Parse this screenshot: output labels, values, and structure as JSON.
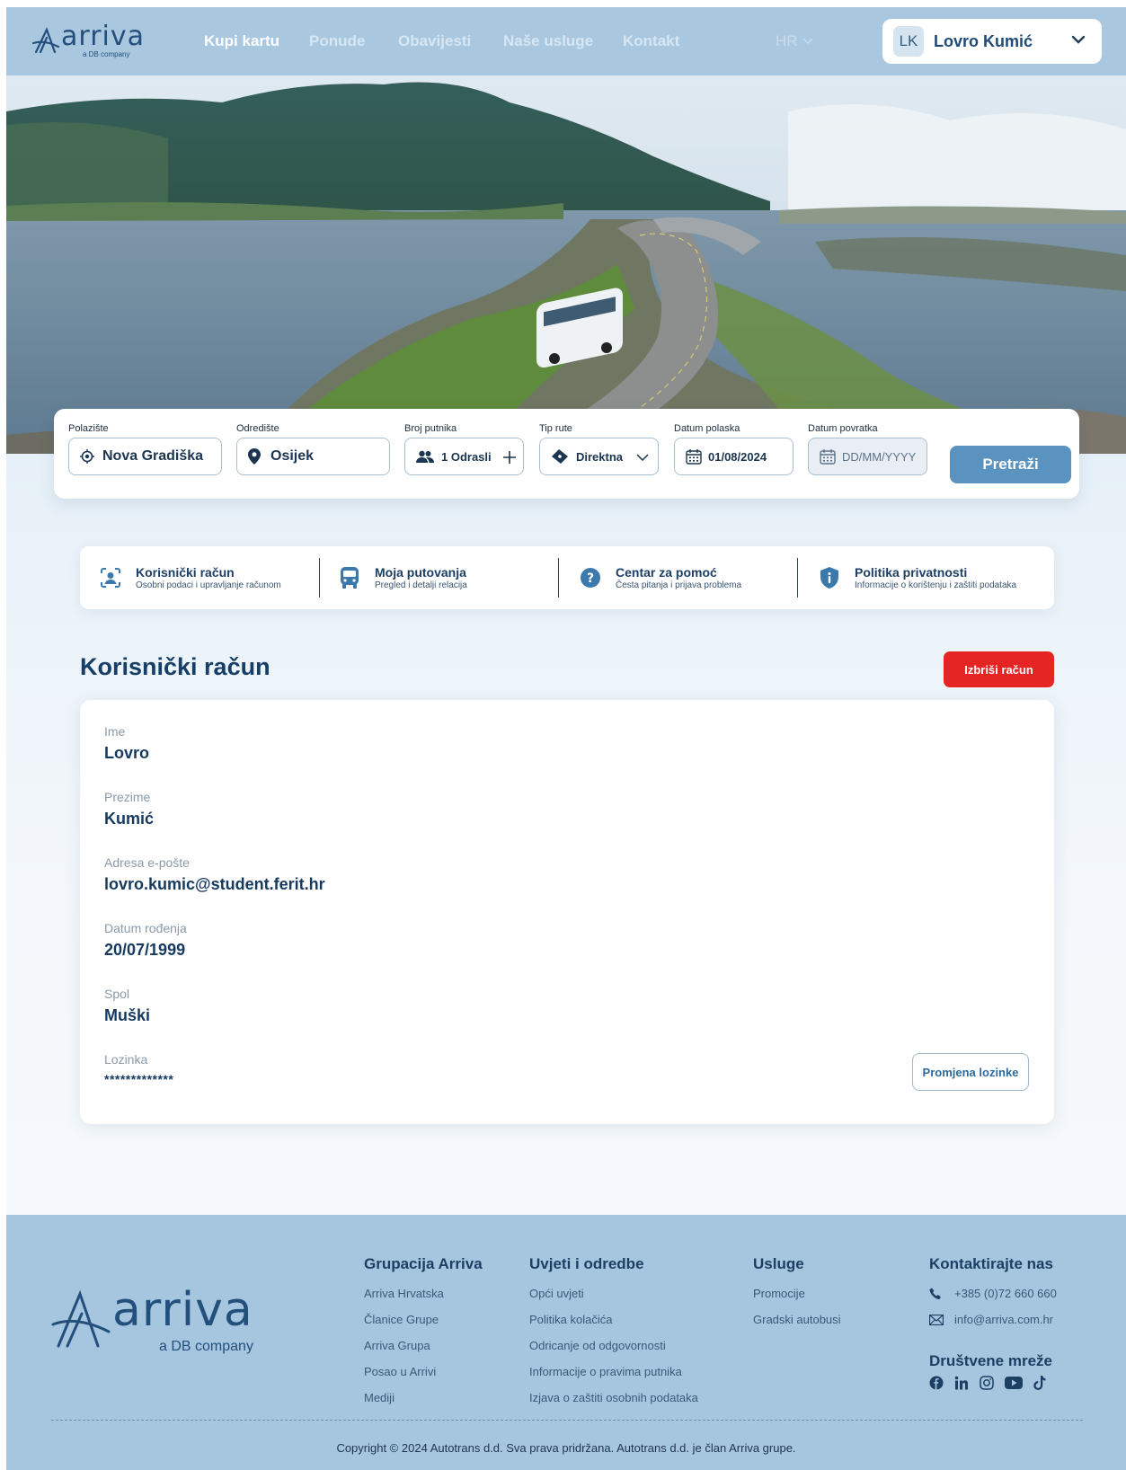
{
  "header": {
    "logo_text": "arriva",
    "logo_sub": "a DB company",
    "nav": [
      "Kupi kartu",
      "Ponude",
      "Obavijesti",
      "Naše usluge",
      "Kontakt"
    ],
    "lang": "HR",
    "user_initials": "LK",
    "user_name": "Lovro Kumić"
  },
  "search": {
    "from_label": "Polazište",
    "from_value": "Nova Gradiška",
    "to_label": "Odredište",
    "to_value": "Osijek",
    "passengers_label": "Broj putnika",
    "passengers_value": "1 Odrasli",
    "route_label": "Tip rute",
    "route_value": "Direktna",
    "depart_label": "Datum polaska",
    "depart_value": "01/08/2024",
    "return_label": "Datum povratka",
    "return_placeholder": "DD/MM/YYYY",
    "submit": "Pretraži"
  },
  "tabs": [
    {
      "title": "Korisnički račun",
      "subtitle": "Osobni podaci i upravljanje računom"
    },
    {
      "title": "Moja putovanja",
      "subtitle": "Pregled i detalji relacija"
    },
    {
      "title": "Centar za pomoć",
      "subtitle": "Česta pitanja i prijava problema"
    },
    {
      "title": "Politika privatnosti",
      "subtitle": "Informacije o korištenju i zaštiti podataka"
    }
  ],
  "account": {
    "title": "Korisnički račun",
    "delete_button": "Izbriši račun",
    "fields": [
      {
        "label": "Ime",
        "value": "Lovro"
      },
      {
        "label": "Prezime",
        "value": "Kumić"
      },
      {
        "label": "Adresa e-pošte",
        "value": "lovro.kumic@student.ferit.hr"
      },
      {
        "label": "Datum rođenja",
        "value": "20/07/1999"
      },
      {
        "label": "Spol",
        "value": "Muški"
      },
      {
        "label": "Lozinka",
        "value": "*************"
      }
    ],
    "change_password_button": "Promjena lozinke"
  },
  "footer": {
    "logo_text": "arriva",
    "logo_sub": "a DB company",
    "col1": {
      "title": "Grupacija Arriva",
      "items": [
        "Arriva Hrvatska",
        "Članice Grupe",
        "Arriva Grupa",
        "Posao u Arrivi",
        "Mediji"
      ]
    },
    "col2": {
      "title": "Uvjeti i odredbe",
      "items": [
        "Opći uvjeti",
        "Politika kolačića",
        "Odricanje od odgovornosti",
        "Informacije o pravima putnika",
        "Izjava o zaštiti osobnih podataka"
      ]
    },
    "col3": {
      "title": "Usluge",
      "items": [
        "Promocije",
        "Gradski autobusi"
      ]
    },
    "contact": {
      "title": "Kontaktirajte nas",
      "phone": "+385 (0)72 660 660",
      "email": "info@arriva.com.hr"
    },
    "social": {
      "title": "Društvene mreže",
      "icons": [
        "facebook-icon",
        "linkedin-icon",
        "instagram-icon",
        "youtube-icon",
        "tiktok-icon"
      ]
    },
    "copyright": "Copyright © 2024 Autotrans d.d. Sva prava pridržana. Autotrans d.d. je član Arriva grupe."
  },
  "colors": {
    "header_bg": "#a9c8e0",
    "accent": "#5b93c0",
    "danger": "#e52424",
    "footer_bg": "#a6c6df",
    "title": "#163e66"
  }
}
